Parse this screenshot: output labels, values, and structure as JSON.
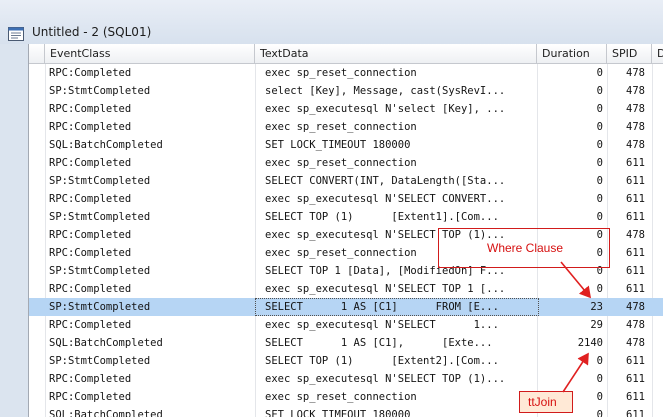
{
  "window": {
    "title": "Untitled - 2 (SQL01)"
  },
  "columns": [
    "EventClass",
    "TextData",
    "Duration",
    "SPID",
    "D"
  ],
  "rows": [
    {
      "event": "RPC:Completed",
      "text": "exec sp_reset_connection",
      "duration": "0",
      "spid": "478"
    },
    {
      "event": "SP:StmtCompleted",
      "text": "select [Key], Message, cast(SysRevI...",
      "duration": "0",
      "spid": "478"
    },
    {
      "event": "RPC:Completed",
      "text": "exec sp_executesql N'select [Key], ...",
      "duration": "0",
      "spid": "478"
    },
    {
      "event": "RPC:Completed",
      "text": "exec sp_reset_connection",
      "duration": "0",
      "spid": "478"
    },
    {
      "event": "SQL:BatchCompleted",
      "text": "SET LOCK_TIMEOUT 180000",
      "duration": "0",
      "spid": "478"
    },
    {
      "event": "RPC:Completed",
      "text": "exec sp_reset_connection",
      "duration": "0",
      "spid": "611"
    },
    {
      "event": "SP:StmtCompleted",
      "text": "SELECT CONVERT(INT, DataLength([Sta...",
      "duration": "0",
      "spid": "611"
    },
    {
      "event": "RPC:Completed",
      "text": "exec sp_executesql N'SELECT CONVERT...",
      "duration": "0",
      "spid": "611"
    },
    {
      "event": "SP:StmtCompleted",
      "text": "SELECT TOP (1)      [Extent1].[Com...",
      "duration": "0",
      "spid": "611"
    },
    {
      "event": "RPC:Completed",
      "text": "exec sp_executesql N'SELECT TOP (1)...",
      "duration": "0",
      "spid": "478"
    },
    {
      "event": "RPC:Completed",
      "text": "exec sp_reset_connection",
      "duration": "0",
      "spid": "611"
    },
    {
      "event": "SP:StmtCompleted",
      "text": "SELECT TOP 1 [Data], [ModifiedOn] F...",
      "duration": "0",
      "spid": "611"
    },
    {
      "event": "RPC:Completed",
      "text": "exec sp_executesql N'SELECT TOP 1 [...",
      "duration": "0",
      "spid": "611"
    },
    {
      "event": "SP:StmtCompleted",
      "text": "SELECT      1 AS [C1]      FROM [E...",
      "duration": "23",
      "spid": "478",
      "selected": true
    },
    {
      "event": "RPC:Completed",
      "text": "exec sp_executesql N'SELECT      1...",
      "duration": "29",
      "spid": "478"
    },
    {
      "event": "SQL:BatchCompleted",
      "text": "SELECT      1 AS [C1],      [Exte...",
      "duration": "2140",
      "spid": "478"
    },
    {
      "event": "SP:StmtCompleted",
      "text": "SELECT TOP (1)      [Extent2].[Com...",
      "duration": "0",
      "spid": "611"
    },
    {
      "event": "RPC:Completed",
      "text": "exec sp_executesql N'SELECT TOP (1)...",
      "duration": "0",
      "spid": "611"
    },
    {
      "event": "RPC:Completed",
      "text": "exec sp_reset_connection",
      "duration": "0",
      "spid": "611"
    },
    {
      "event": "SQL:BatchCompleted",
      "text": "SET LOCK_TIMEOUT 180000",
      "duration": "0",
      "spid": "611"
    }
  ],
  "annotations": {
    "where_clause": "Where Clause",
    "join": "ttJoin",
    "color": "#d61010"
  }
}
